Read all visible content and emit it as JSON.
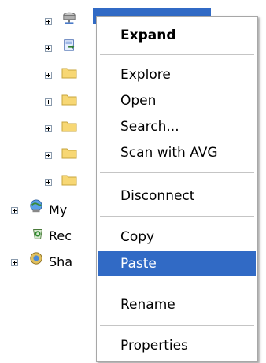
{
  "tree": {
    "items": [
      {
        "icon": "network-drive-icon",
        "label": ""
      },
      {
        "icon": "shortcut-icon",
        "label": ""
      },
      {
        "icon": "folder-icon",
        "label": ""
      },
      {
        "icon": "folder-icon",
        "label": ""
      },
      {
        "icon": "folder-icon",
        "label": ""
      },
      {
        "icon": "folder-icon",
        "label": ""
      },
      {
        "icon": "folder-icon",
        "label": ""
      },
      {
        "icon": "my-network-places-icon",
        "label": "My"
      },
      {
        "icon": "recycle-bin-icon",
        "label": "Rec"
      },
      {
        "icon": "shared-icon",
        "label": "Sha"
      }
    ]
  },
  "context_menu": {
    "items": [
      {
        "label": "Expand",
        "bold": true
      },
      {
        "label": "Explore"
      },
      {
        "label": "Open"
      },
      {
        "label": "Search..."
      },
      {
        "label": "Scan with AVG"
      },
      {
        "label": "Disconnect"
      },
      {
        "label": "Copy"
      },
      {
        "label": "Paste",
        "highlighted": true
      },
      {
        "label": "Rename"
      },
      {
        "label": "Properties"
      }
    ]
  },
  "colors": {
    "selection": "#316ac5",
    "folder": "#f7d774"
  }
}
